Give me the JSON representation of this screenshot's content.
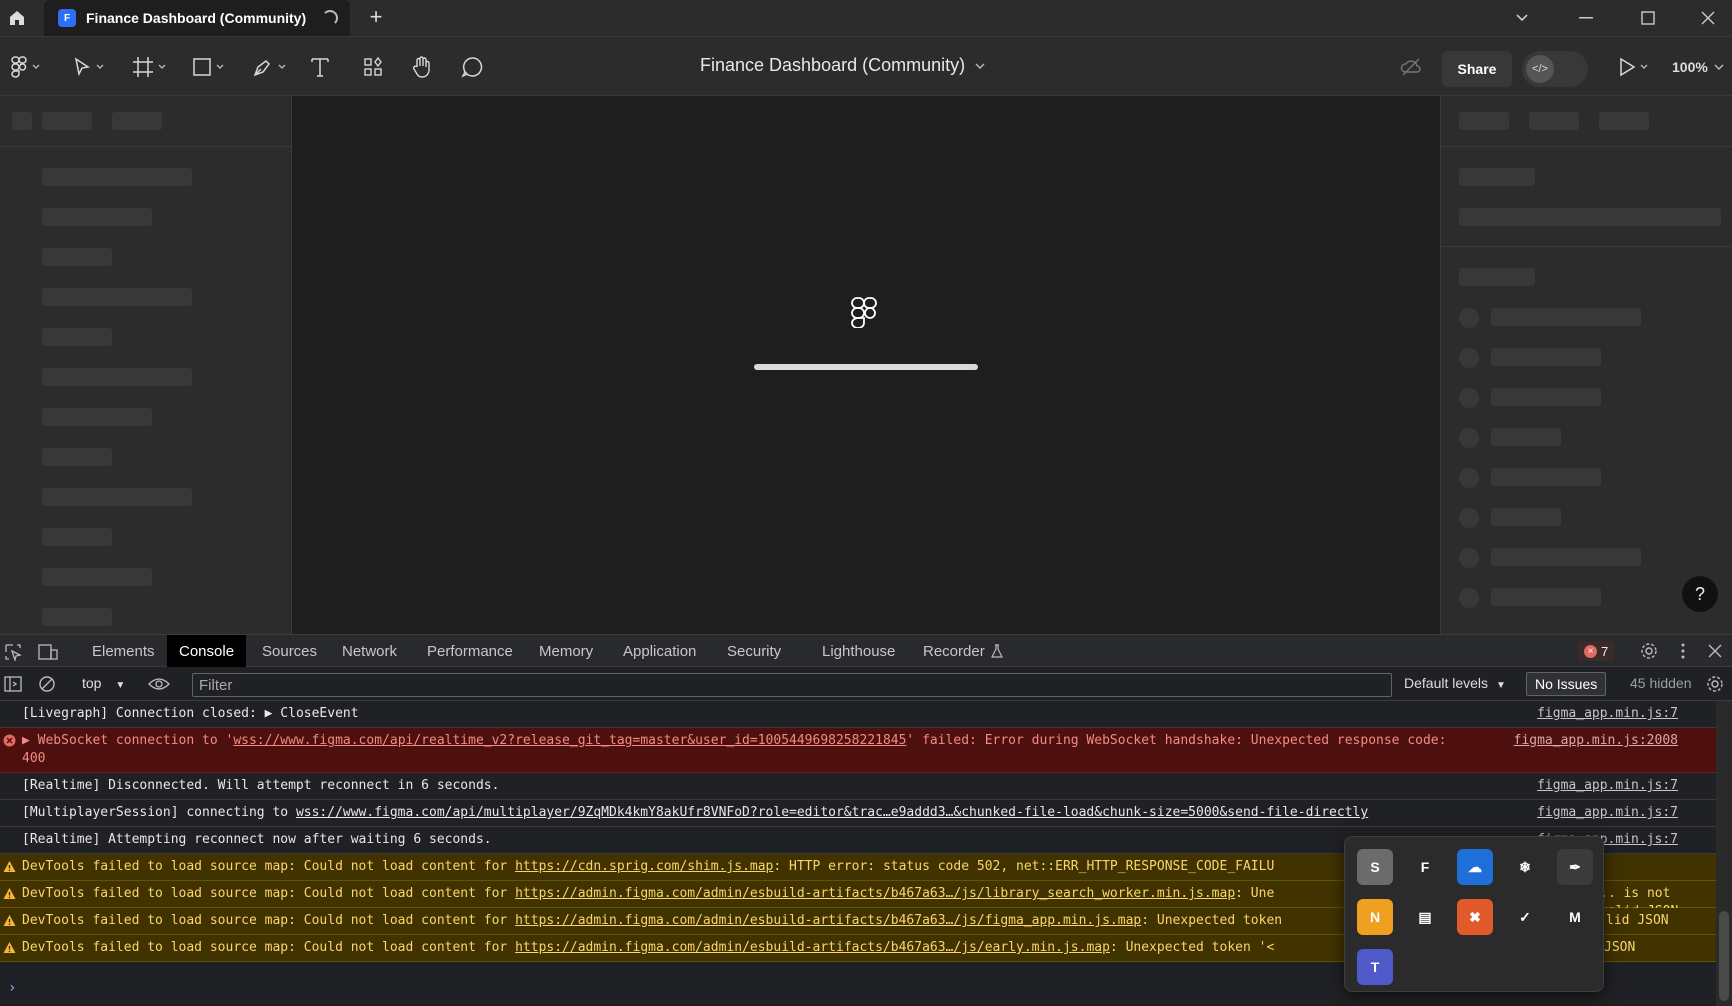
{
  "browser": {
    "tab_title": "Finance Dashboard (Community)",
    "new_tab_label": "+",
    "window_controls": [
      "chevron-down",
      "minimize",
      "maximize",
      "close"
    ]
  },
  "toolbar": {
    "doc_title": "Finance Dashboard (Community)",
    "share_label": "Share",
    "zoom": "100%",
    "tools": [
      "figma-menu-icon",
      "move-icon",
      "frame-icon",
      "shape-icon",
      "pen-icon",
      "text-icon",
      "resources-icon",
      "hand-icon",
      "comment-icon"
    ]
  },
  "canvas": {
    "loading_progress": 1.0,
    "help_label": "?"
  },
  "devtools": {
    "tabs": [
      "Elements",
      "Console",
      "Sources",
      "Network",
      "Performance",
      "Memory",
      "Application",
      "Security",
      "Lighthouse",
      "Recorder"
    ],
    "active_tab": "Console",
    "error_count": "7",
    "context": "top",
    "filter_placeholder": "Filter",
    "levels": "Default levels",
    "issues": "No Issues",
    "hidden": "45 hidden",
    "logs": [
      {
        "type": "plain",
        "text": "[Livegraph] Connection closed:  ",
        "extra": "▶ CloseEvent",
        "source": "figma_app.min.js:7"
      },
      {
        "type": "error",
        "prefix": "▶ WebSocket connection to '",
        "link": "wss://www.figma.com/api/realtime_v2?release_git_tag=master&user_id=1005449698258221845",
        "suffix": "' failed: Error during WebSocket handshake: Unexpected response code: 400",
        "source": "figma_app.min.js:2008"
      },
      {
        "type": "plain",
        "text": "[Realtime] Disconnected. Will attempt reconnect in 6 seconds.",
        "source": "figma_app.min.js:7"
      },
      {
        "type": "plain",
        "prefix": "[MultiplayerSession] connecting to ",
        "link": "wss://www.figma.com/api/multiplayer/9ZqMDk4kmY8akUfr8VNFoD?role=editor&trac…e9addd3…&chunked-file-load&chunk-size=5000&send-file-directly",
        "source": "figma_app.min.js:7"
      },
      {
        "type": "plain",
        "text": "[Realtime] Attempting reconnect now after waiting 6 seconds.",
        "source": "figma_app.min.js:7"
      },
      {
        "type": "warn",
        "prefix": "DevTools failed to load source map: Could not load content for ",
        "link": "https://cdn.sprig.com/shim.js.map",
        "suffix": ": HTTP error: status code 502, net::ERR_HTTP_RESPONSE_CODE_FAILU"
      },
      {
        "type": "warn",
        "prefix": "DevTools failed to load source map: Could not load content for ",
        "link": "https://admin.figma.com/admin/esbuild-artifacts/b467a63…/js/library_search_worker.min.js.map",
        "suffix": ": Une",
        "tail": ".. is not valid JSON"
      },
      {
        "type": "warn",
        "prefix": "DevTools failed to load source map: Could not load content for ",
        "link": "https://admin.figma.com/admin/esbuild-artifacts/b467a63…/js/figma_app.min.js.map",
        "suffix": ": Unexpected token",
        "tail": "lid JSON"
      },
      {
        "type": "warn",
        "prefix": "DevTools failed to load source map: Could not load content for ",
        "link": "https://admin.figma.com/admin/esbuild-artifacts/b467a63…/js/early.min.js.map",
        "suffix": ": Unexpected token '<",
        "tail": "JSON"
      }
    ]
  },
  "tray": {
    "icons": [
      {
        "name": "skype-icon",
        "glyph": "S",
        "color": "#6b6b6b"
      },
      {
        "name": "figma-tray-icon",
        "glyph": "F",
        "color": "#2b2b2b"
      },
      {
        "name": "onedrive-icon",
        "glyph": "☁",
        "color": "#1e6fd9"
      },
      {
        "name": "snowflake-icon",
        "glyph": "❄",
        "color": "#2b2b2b"
      },
      {
        "name": "feather-icon",
        "glyph": "✒",
        "color": "#3b3b3b"
      },
      {
        "name": "norton-icon",
        "glyph": "N",
        "color": "#f0a020"
      },
      {
        "name": "display-icon",
        "glyph": "▤",
        "color": "#2b2b2b"
      },
      {
        "name": "antivirus-icon",
        "glyph": "✖",
        "color": "#e05a2a"
      },
      {
        "name": "monitor-icon",
        "glyph": "✓",
        "color": "#2b2b2b"
      },
      {
        "name": "meta-icon",
        "glyph": "M",
        "color": "#2b2b2b"
      },
      {
        "name": "teams-icon",
        "glyph": "T",
        "color": "#5059c9"
      }
    ]
  }
}
